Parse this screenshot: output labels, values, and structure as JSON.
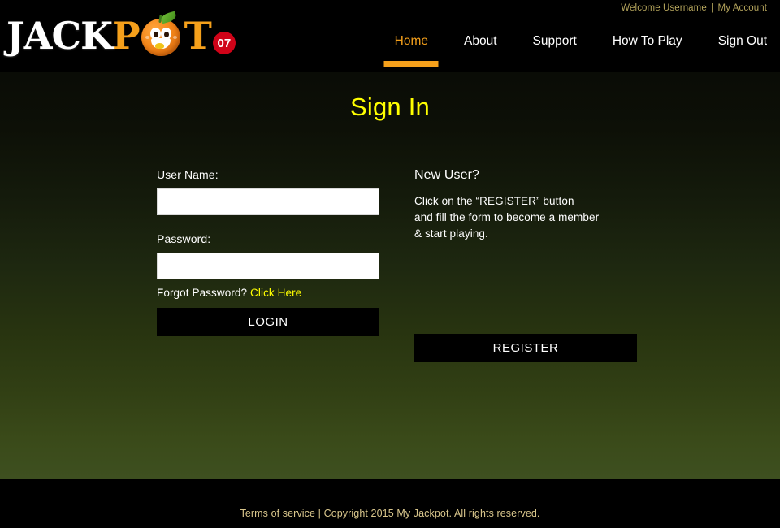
{
  "brand": {
    "word_white": "JACK",
    "word_p": "P",
    "word_t": "T",
    "badge": "07",
    "mascot_icon": "orange-fruit-mascot-icon",
    "accent_orange": "#f5a01b",
    "badge_red": "#d00318"
  },
  "header": {
    "welcome_text": "Welcome Username",
    "separator": "|",
    "account_link": "My Account",
    "welcome_color": "#b3a35b",
    "nav": [
      {
        "label": "Home",
        "active": true
      },
      {
        "label": "About",
        "active": false
      },
      {
        "label": "Support",
        "active": false
      },
      {
        "label": "How To Play",
        "active": false
      },
      {
        "label": "Sign Out",
        "active": false
      }
    ]
  },
  "main": {
    "page_title": "Sign In",
    "title_color": "#ffff00",
    "divider_color": "#e8e81a",
    "sign_in": {
      "username_label": "User Name:",
      "username_value": "",
      "username_placeholder": "",
      "password_label": "Password:",
      "password_value": "",
      "password_placeholder": "",
      "forgot_text": "Forgot Password?",
      "forgot_link": "Click Here",
      "login_button": "LOGIN"
    },
    "new_user": {
      "heading": "New User?",
      "line1": "Click on the “REGISTER” button",
      "line2": "and fill the form to become a member",
      "line3": "& start playing.",
      "register_button": "REGISTER"
    }
  },
  "footer": {
    "text": "Terms of service | Copyright 2015 My Jackpot. All rights reserved.",
    "text_color": "#d9c68c"
  }
}
